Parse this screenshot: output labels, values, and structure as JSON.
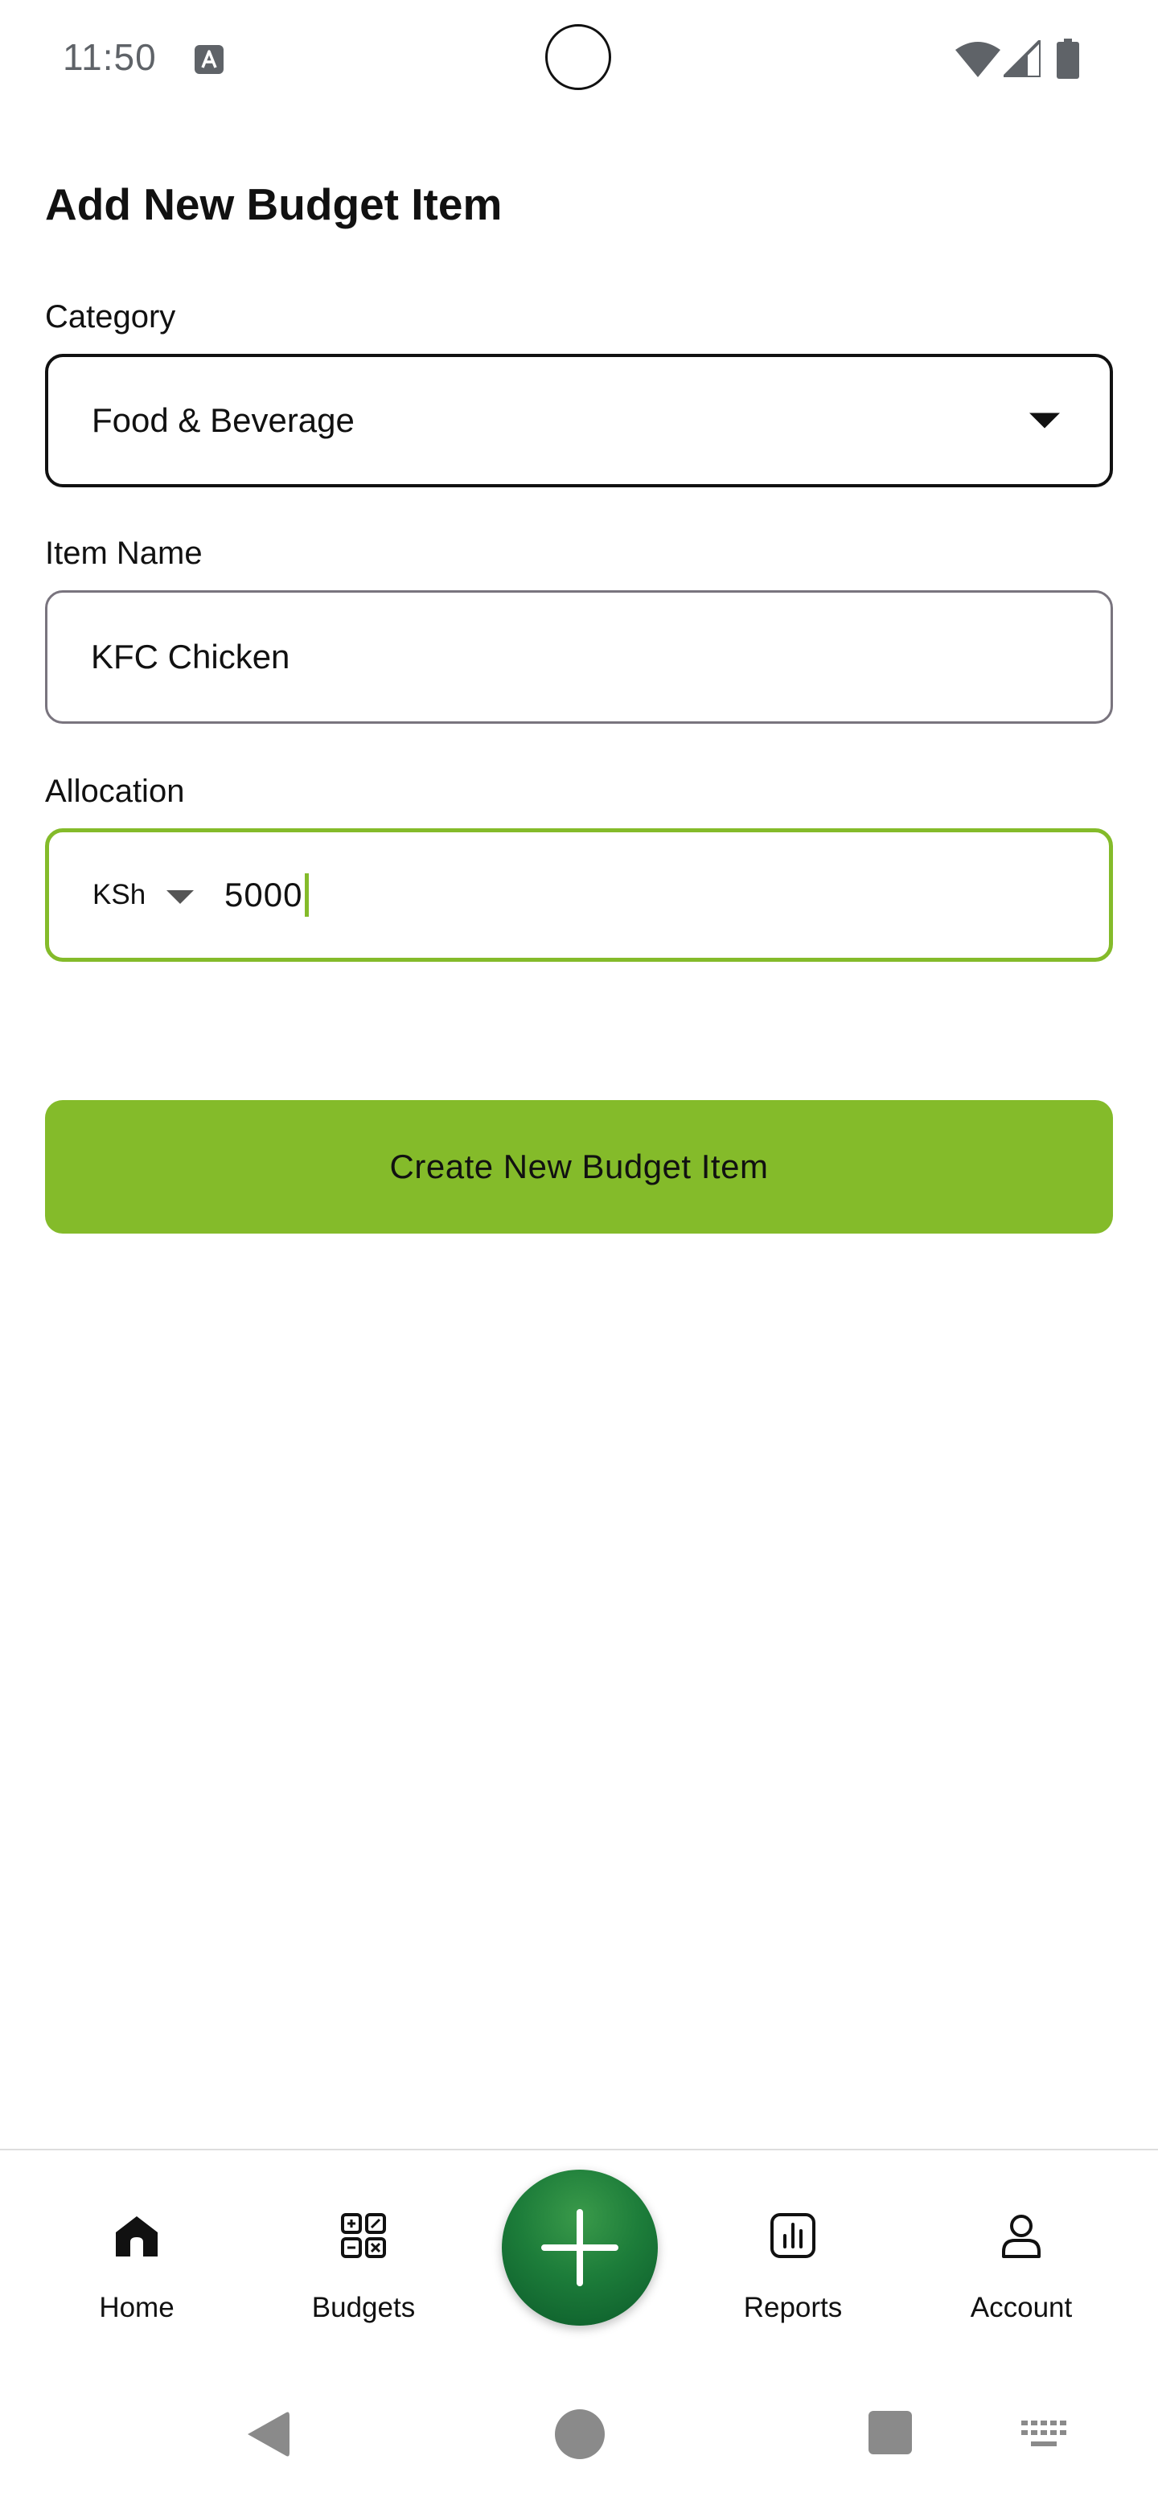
{
  "status_bar": {
    "time": "11:50",
    "icons": [
      "font-a-icon",
      "wifi-icon",
      "signal-icon",
      "battery-icon"
    ]
  },
  "page": {
    "title": "Add New Budget Item"
  },
  "form": {
    "category": {
      "label": "Category",
      "value": "Food & Beverage"
    },
    "item_name": {
      "label": "Item Name",
      "value": "KFC Chicken"
    },
    "allocation": {
      "label": "Allocation",
      "currency": "KSh",
      "value": "5000"
    },
    "submit_label": "Create New Budget Item"
  },
  "bottom_nav": {
    "items": [
      {
        "label": "Home",
        "icon": "home-icon"
      },
      {
        "label": "Budgets",
        "icon": "budgets-grid-icon"
      },
      {
        "label": "Reports",
        "icon": "bar-chart-icon"
      },
      {
        "label": "Account",
        "icon": "person-icon"
      }
    ],
    "fab_icon": "plus-icon"
  },
  "system_nav": {
    "icons": [
      "back-icon",
      "home-circle-icon",
      "recents-icon",
      "keyboard-icon"
    ]
  },
  "colors": {
    "accent": "#84bb2a",
    "fab_green": "#1d7d3a",
    "text": "#111111",
    "status_grey": "#5f6368"
  }
}
